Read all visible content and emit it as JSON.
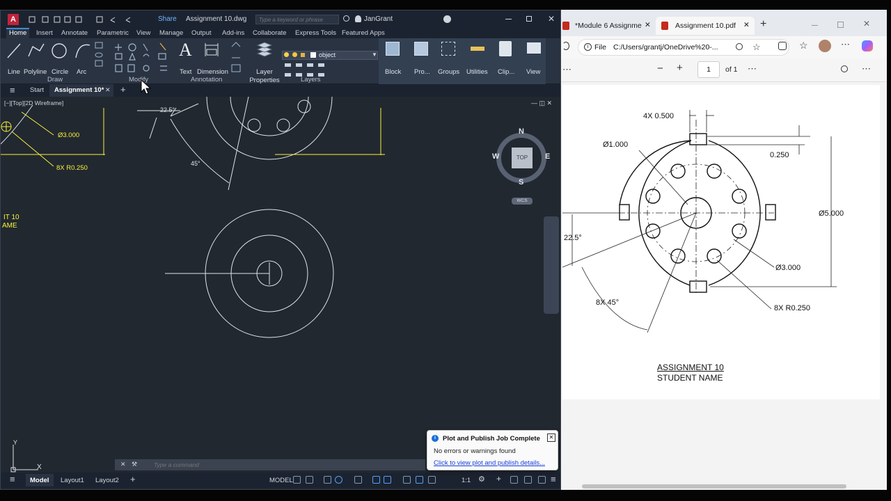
{
  "autocad": {
    "title": {
      "logo": "A",
      "share": "Share",
      "file": "Assignment 10.dwg",
      "search_placeholder": "Type a keyword or phrase",
      "user": "JanGrant"
    },
    "ribbon_tabs": [
      "Home",
      "Insert",
      "Annotate",
      "Parametric",
      "View",
      "Manage",
      "Output",
      "Add-ins",
      "Collaborate",
      "Express Tools",
      "Featured Apps"
    ],
    "draw_tools": [
      "Line",
      "Polyline",
      "Circle",
      "Arc"
    ],
    "annotation_tools": [
      "Text",
      "Dimension"
    ],
    "layer_props": "Layer Properties",
    "layer_current": "object",
    "right_tools": [
      "Block",
      "Pro...",
      "Groups",
      "Utilities",
      "Clip...",
      "View"
    ],
    "panels": [
      "Draw",
      "Modify",
      "Annotation",
      "Layers"
    ],
    "file_tabs": {
      "menu": "≡",
      "start": "Start",
      "active": "Assignment 10*",
      "add": "+"
    },
    "viewport_label": "[−][Top][2D Wireframe]",
    "drawing_labels": {
      "dia3": "Ø3.000",
      "r025": "8X R0.250",
      "angle225": "22.5°",
      "angle45": "45°",
      "title_partial": "IT 10",
      "name_partial": "AME"
    },
    "viewcube": {
      "n": "N",
      "s": "S",
      "e": "E",
      "w": "W",
      "top": "TOP",
      "wcs": "WCS"
    },
    "ucs": {
      "x": "X",
      "y": "Y"
    },
    "command_placeholder": "Type a command",
    "layout_tabs": [
      "Model",
      "Layout1",
      "Layout2",
      "+"
    ],
    "status": {
      "model": "MODEL",
      "scale": "1:1"
    },
    "notification": {
      "title": "Plot and Publish Job Complete",
      "body": "No errors or warnings found",
      "link": "Click to view plot and publish details..."
    }
  },
  "edge": {
    "tabs": [
      {
        "label": "*Module 6 Assignme",
        "icon": "pdf-icon"
      },
      {
        "label": "Assignment 10.pdf",
        "icon": "pdf-icon"
      }
    ],
    "address_prefix": "File",
    "address": "C:/Users/grantj/OneDrive%20-...",
    "page_current": "1",
    "page_total": "of 1",
    "drawing": {
      "slots": "4X 0.500",
      "dia1": "Ø1.000",
      "depth": "0.250",
      "dia5": "Ø5.000",
      "angle225": "22.5°",
      "dia3": "Ø3.000",
      "angle45": "8X 45°",
      "radius": "8X R0.250",
      "title": "ASSIGNMENT 10",
      "name": "STUDENT NAME"
    }
  }
}
